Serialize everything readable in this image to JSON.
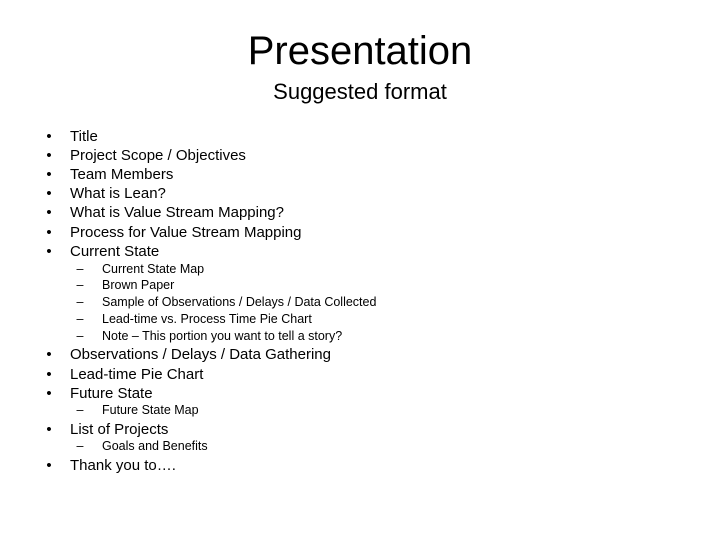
{
  "slide": {
    "title": "Presentation",
    "subtitle": "Suggested format",
    "bullet_glyph": "•",
    "sub_bullet_glyph": "–",
    "items": [
      {
        "level": 1,
        "text": "Title"
      },
      {
        "level": 1,
        "text": "Project Scope / Objectives"
      },
      {
        "level": 1,
        "text": "Team Members"
      },
      {
        "level": 1,
        "text": "What is Lean?"
      },
      {
        "level": 1,
        "text": "What is Value Stream Mapping?"
      },
      {
        "level": 1,
        "text": "Process for Value Stream Mapping"
      },
      {
        "level": 1,
        "text": "Current State"
      },
      {
        "level": 2,
        "text": "Current State Map"
      },
      {
        "level": 2,
        "text": "Brown Paper"
      },
      {
        "level": 2,
        "text": "Sample of Observations / Delays / Data Collected"
      },
      {
        "level": 2,
        "text": "Lead-time vs. Process Time Pie Chart"
      },
      {
        "level": 2,
        "text": "Note – This portion you want to tell a story?"
      },
      {
        "level": 1,
        "text": "Observations / Delays / Data Gathering"
      },
      {
        "level": 1,
        "text": "Lead-time Pie Chart"
      },
      {
        "level": 1,
        "text": "Future State"
      },
      {
        "level": 2,
        "text": "Future State Map"
      },
      {
        "level": 1,
        "text": "List of Projects"
      },
      {
        "level": 2,
        "text": "Goals and Benefits"
      },
      {
        "level": 1,
        "text": "Thank you to…."
      }
    ]
  }
}
